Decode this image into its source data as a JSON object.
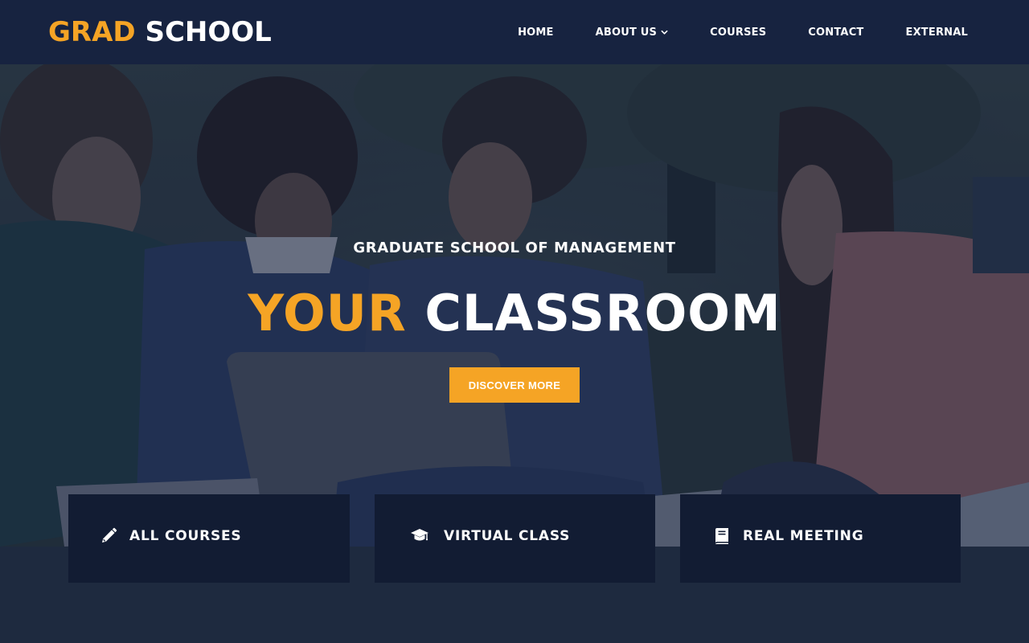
{
  "brand": {
    "logo_accent": "GRAD",
    "logo_main": "SCHOOL",
    "accent_color": "#f5a425",
    "header_bg": "#172340",
    "card_bg": "#121c33"
  },
  "nav": {
    "items": [
      {
        "label": "HOME",
        "icon": null
      },
      {
        "label": "ABOUT US",
        "icon": "chevron-down-icon"
      },
      {
        "label": "COURSES",
        "icon": null
      },
      {
        "label": "CONTACT",
        "icon": null
      },
      {
        "label": "EXTERNAL",
        "icon": null
      }
    ]
  },
  "hero": {
    "subtitle": "GRADUATE SCHOOL OF MANAGEMENT",
    "title_accent": "YOUR",
    "title_main": "CLASSROOM",
    "cta_label": "DISCOVER MORE"
  },
  "features": [
    {
      "label": "ALL COURSES",
      "icon": "pencil-icon"
    },
    {
      "label": "VIRTUAL CLASS",
      "icon": "graduation-cap-icon"
    },
    {
      "label": "REAL MEETING",
      "icon": "book-icon"
    }
  ]
}
